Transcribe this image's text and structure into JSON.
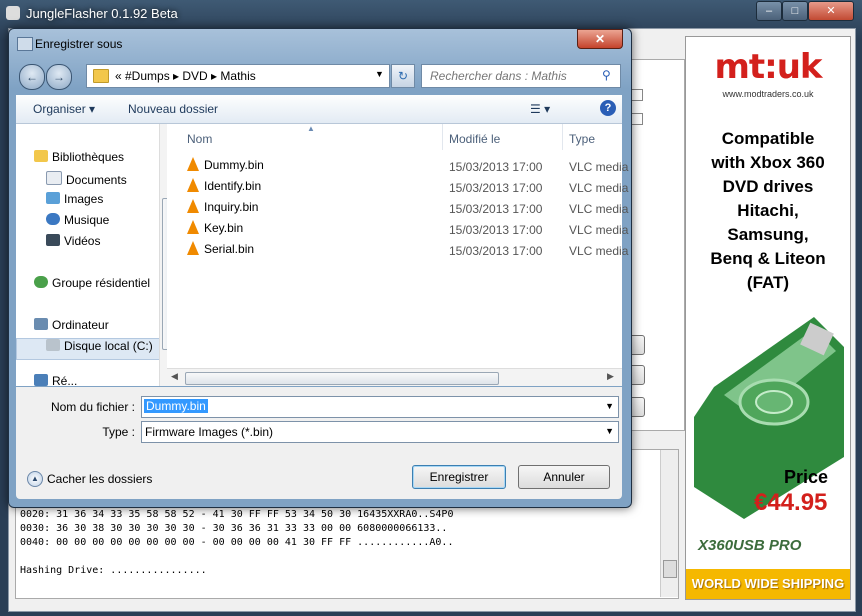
{
  "main_window": {
    "title": "JungleFlasher 0.1.92 Beta",
    "min_label": "–",
    "max_label": "□",
    "close_label": "✕"
  },
  "dialog": {
    "title": "Enregistrer sous",
    "close_label": "✕",
    "back_icon": "←",
    "forward_icon": "→",
    "address": {
      "crumbs": "«  #Dumps  ▸  DVD  ▸  Mathis"
    },
    "refresh_icon": "↻",
    "search_placeholder": "Rechercher dans : Mathis",
    "toolbar": {
      "organize_label": "Organiser ▾",
      "new_folder_label": "Nouveau dossier",
      "view_label": "☰ ▾",
      "help_label": "?"
    },
    "nav": {
      "libraries": "Bibliothèques",
      "documents": "Documents",
      "images": "Images",
      "music": "Musique",
      "videos": "Vidéos",
      "homegroup": "Groupe résidentiel",
      "computer": "Ordinateur",
      "local_disk": "Disque local (C:)",
      "network": "Ré..."
    },
    "columns": {
      "name": "Nom",
      "modified": "Modifié le",
      "type": "Type"
    },
    "files": [
      {
        "name": "Dummy.bin",
        "modified": "15/03/2013 17:00",
        "type": "VLC media"
      },
      {
        "name": "Identify.bin",
        "modified": "15/03/2013 17:00",
        "type": "VLC media"
      },
      {
        "name": "Inquiry.bin",
        "modified": "15/03/2013 17:00",
        "type": "VLC media"
      },
      {
        "name": "Key.bin",
        "modified": "15/03/2013 17:00",
        "type": "VLC media"
      },
      {
        "name": "Serial.bin",
        "modified": "15/03/2013 17:00",
        "type": "VLC media"
      }
    ],
    "filename_label": "Nom du fichier :",
    "filename_value": "Dummy.bin",
    "type_label": "Type :",
    "type_value": "Firmware Images (*.bin)",
    "hide_folders_label": "Cacher les dossiers",
    "save_label": "Enregistrer",
    "cancel_label": "Annuler"
  },
  "log": {
    "lines": "0020: 31 36 34 33 35 58 58 52 - 41 30 FF FF 53 34 50 30 16435XXRA0..S4P0\n0030: 36 30 38 30 30 30 30 30 - 30 36 36 31 33 33 00 00 6080000066133..\n0040: 00 00 00 00 00 00 00 00 - 00 00 00 00 41 30 FF FF ............A0..\n\nHashing Drive: ................"
  },
  "ad": {
    "logo": "mt:uk",
    "url": "www.modtraders.co.uk",
    "headline": "Compatible\nwith Xbox 360\nDVD drives\nHitachi,\nSamsung,\nBenq & Liteon\n(FAT)",
    "price_label": "Price",
    "price": "€44.95",
    "brand": "X360USB PRO",
    "shipping": "WORLD WIDE SHIPPING"
  },
  "colors": {
    "accent": "#3399ff",
    "vlc_orange": "#f08a00",
    "ad_red": "#d3201c"
  }
}
